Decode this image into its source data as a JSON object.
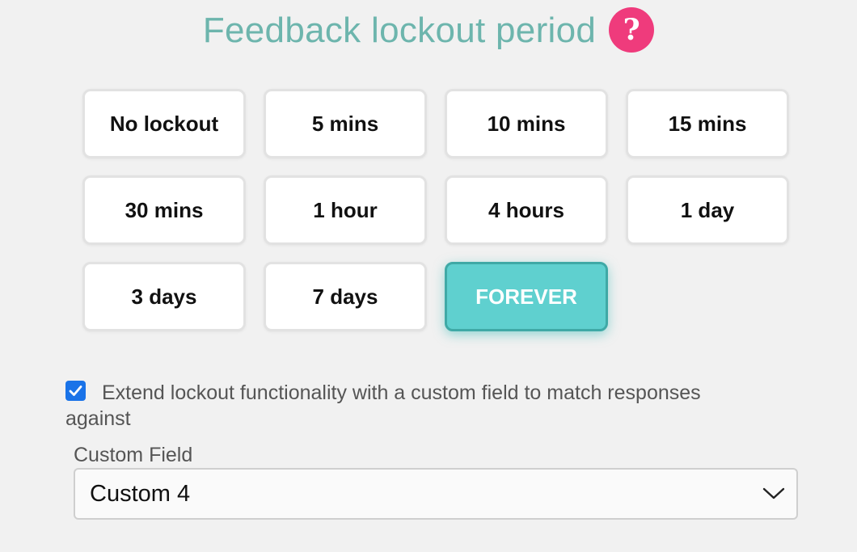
{
  "heading": {
    "title": "Feedback lockout period",
    "help_icon": "question-mark-icon",
    "help_glyph": "?",
    "help_color": "#ef3b7c",
    "title_color": "#6db5ad"
  },
  "lockout_options": [
    {
      "label": "No lockout",
      "selected": false
    },
    {
      "label": "5 mins",
      "selected": false
    },
    {
      "label": "10 mins",
      "selected": false
    },
    {
      "label": "15 mins",
      "selected": false
    },
    {
      "label": "30 mins",
      "selected": false
    },
    {
      "label": "1 hour",
      "selected": false
    },
    {
      "label": "4 hours",
      "selected": false
    },
    {
      "label": "1 day",
      "selected": false
    },
    {
      "label": "3 days",
      "selected": false
    },
    {
      "label": "7 days",
      "selected": false
    },
    {
      "label": "FOREVER",
      "selected": true
    }
  ],
  "accent_color": "#5fd0cf",
  "extend_lockout": {
    "checked": true,
    "label": "Extend lockout functionality with a custom field to match responses against"
  },
  "custom_field": {
    "label": "Custom Field",
    "value": "Custom 4",
    "icon": "chevron-down-icon"
  }
}
